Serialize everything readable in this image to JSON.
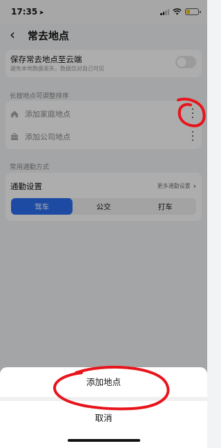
{
  "status_bar": {
    "time": "17:35",
    "location_arrow": "➤"
  },
  "header": {
    "back_icon": "‹",
    "title": "常去地点"
  },
  "sync": {
    "title": "保存常去地点至云端",
    "subtitle": "避免本地数据丢失，数据仅对自己可见",
    "enabled": false
  },
  "places_section_label": "长按地点可调整排序",
  "places": [
    {
      "label": "添加家庭地点",
      "icon": "home-icon"
    },
    {
      "label": "添加公司地点",
      "icon": "briefcase-icon"
    }
  ],
  "commute_section_label": "常用通勤方式",
  "commute": {
    "title": "通勤设置",
    "more_label": "更多通勤设置",
    "modes": [
      "驾车",
      "公交",
      "打车"
    ],
    "selected": "驾车"
  },
  "sheet": {
    "add_label": "添加地点",
    "cancel_label": "取消"
  },
  "colors": {
    "accent": "#2b6ff2",
    "annotation": "#e8141b"
  }
}
